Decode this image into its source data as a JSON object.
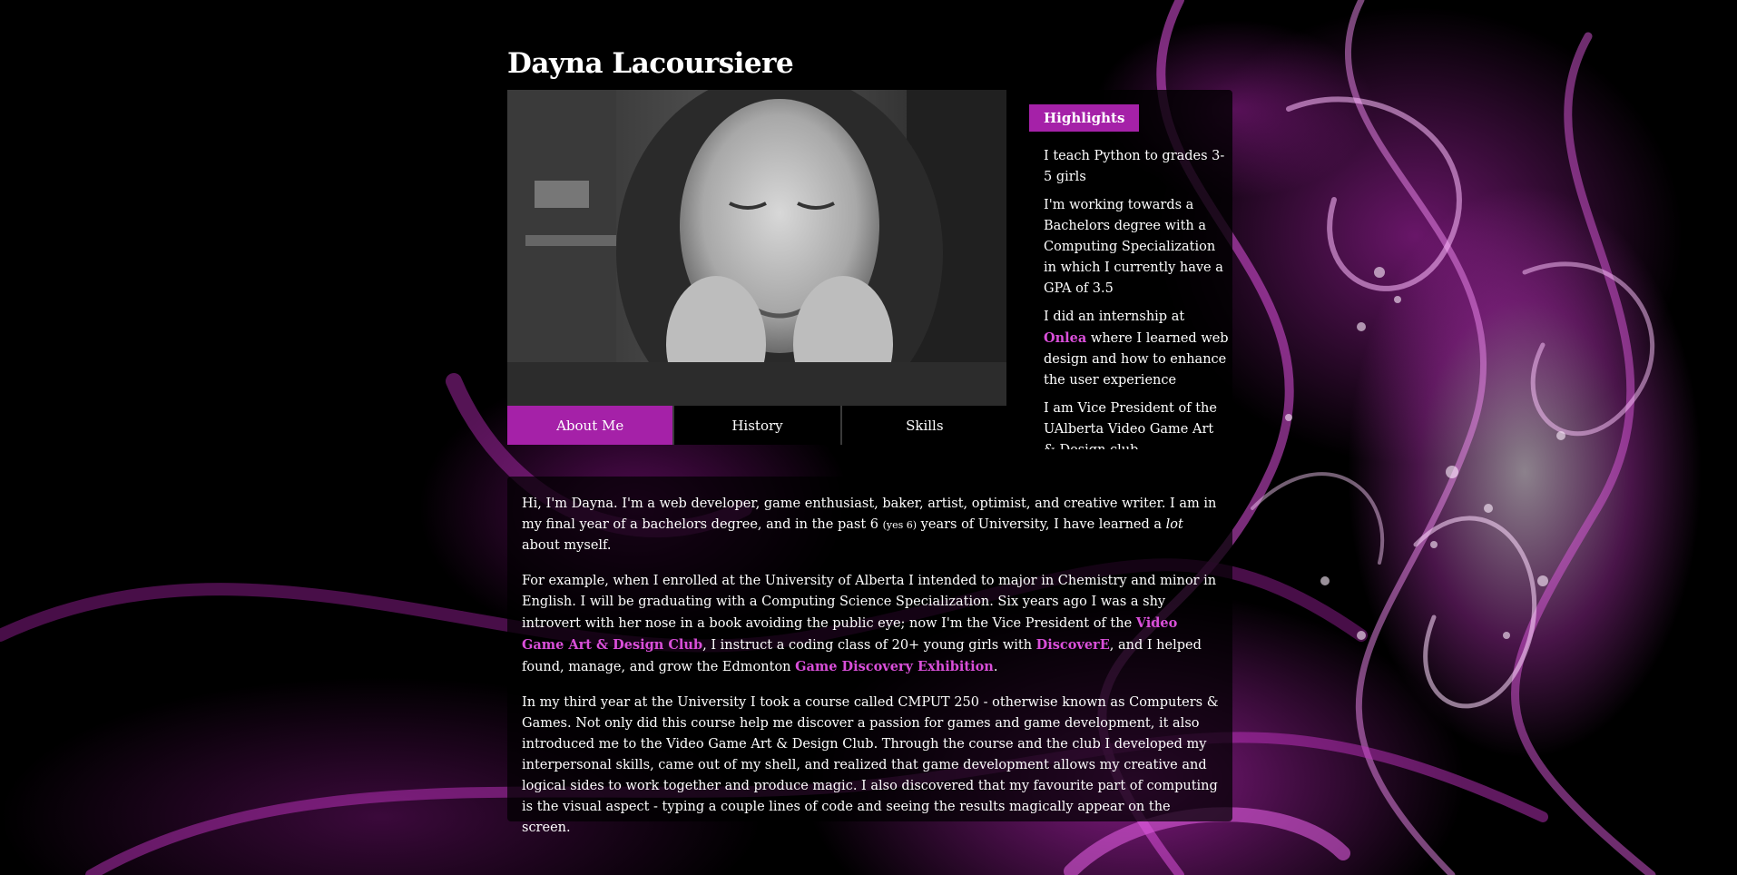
{
  "page": {
    "title": "Dayna Lacoursiere"
  },
  "colors": {
    "accent": "#a521a8",
    "link": "#d94fd9",
    "background": "#000000"
  },
  "hero": {
    "image": "portrait-photo"
  },
  "tabs": [
    {
      "label": "About Me",
      "active": true
    },
    {
      "label": "History",
      "active": false
    },
    {
      "label": "Skills",
      "active": false
    }
  ],
  "highlights": {
    "title": "Highlights",
    "items": [
      {
        "text": "I teach Python to grades 3-5 girls"
      },
      {
        "text": "I'm working towards a Bachelors degree with a Computing Specialization in which I currently have a GPA of 3.5"
      },
      {
        "pre": "I did an internship at ",
        "link": "Onlea",
        "post": " where I learned web design and how to enhance the user experience"
      },
      {
        "text": "I am Vice President of the UAlberta Video Game Art & Design club"
      }
    ]
  },
  "about": {
    "p1": {
      "a": "Hi, I'm Dayna. I'm a web developer, game enthusiast, baker, artist, optimist, and creative writer. I am in my final year of a bachelors degree, and in the past 6 ",
      "small": "(yes 6)",
      "b": " years of University, I have learned a ",
      "em": "lot",
      "c": " about myself."
    },
    "p2": {
      "a": "For example, when I enrolled at the University of Alberta I intended to major in Chemistry and minor in English. I will be graduating with a Computing Science Specialization. Six years ago I was a shy introvert with her nose in a book avoiding the public eye; now I'm the Vice President of the ",
      "link1": "Video Game Art & Design Club",
      "b": ", I instruct a coding class of 20+ young girls with ",
      "link2": "DiscoverE",
      "c": ", and I helped found, manage, and grow the Edmonton ",
      "link3": "Game Discovery Exhibition",
      "d": "."
    },
    "p3": "In my third year at the University I took a course called CMPUT 250 - otherwise known as Computers & Games. Not only did this course help me discover a passion for games and game development, it also introduced me to the Video Game Art & Design Club. Through the course and the club I developed my interpersonal skills, came out of my shell, and realized that game development allows my creative and logical sides to work together and produce magic. I also discovered that my favourite part of computing is the visual aspect - typing a couple lines of code and seeing the results magically appear on the screen."
  }
}
